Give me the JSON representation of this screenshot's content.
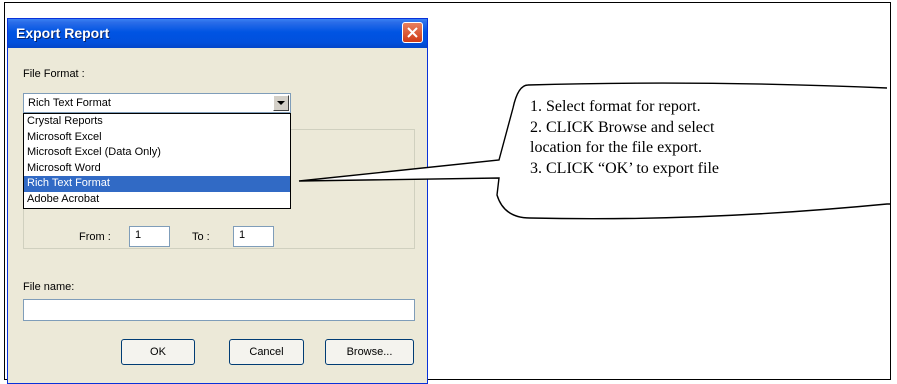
{
  "dialog": {
    "title": "Export Report",
    "file_format_label": "File Format :",
    "file_format_value": "Rich Text Format",
    "format_options": [
      "Crystal Reports",
      "Microsoft Excel",
      "Microsoft Excel (Data Only)",
      "Microsoft Word",
      "Rich Text Format",
      "Adobe Acrobat"
    ],
    "selected_index": 4,
    "from_label": "From :",
    "from_value": "1",
    "to_label": "To :",
    "to_value": "1",
    "file_name_label": "File name:",
    "file_name_value": "",
    "ok_label": "OK",
    "cancel_label": "Cancel",
    "browse_label": "Browse..."
  },
  "callout": {
    "lines": [
      "1. Select format for report.",
      "2. CLICK Browse and select",
      "location for the file export.",
      "3. CLICK “OK’ to export file"
    ]
  },
  "colors": {
    "titlebar": "#0054e3",
    "dialog_bg": "#ece9d8",
    "selection": "#316ac5",
    "close_button": "#cf3a16"
  }
}
